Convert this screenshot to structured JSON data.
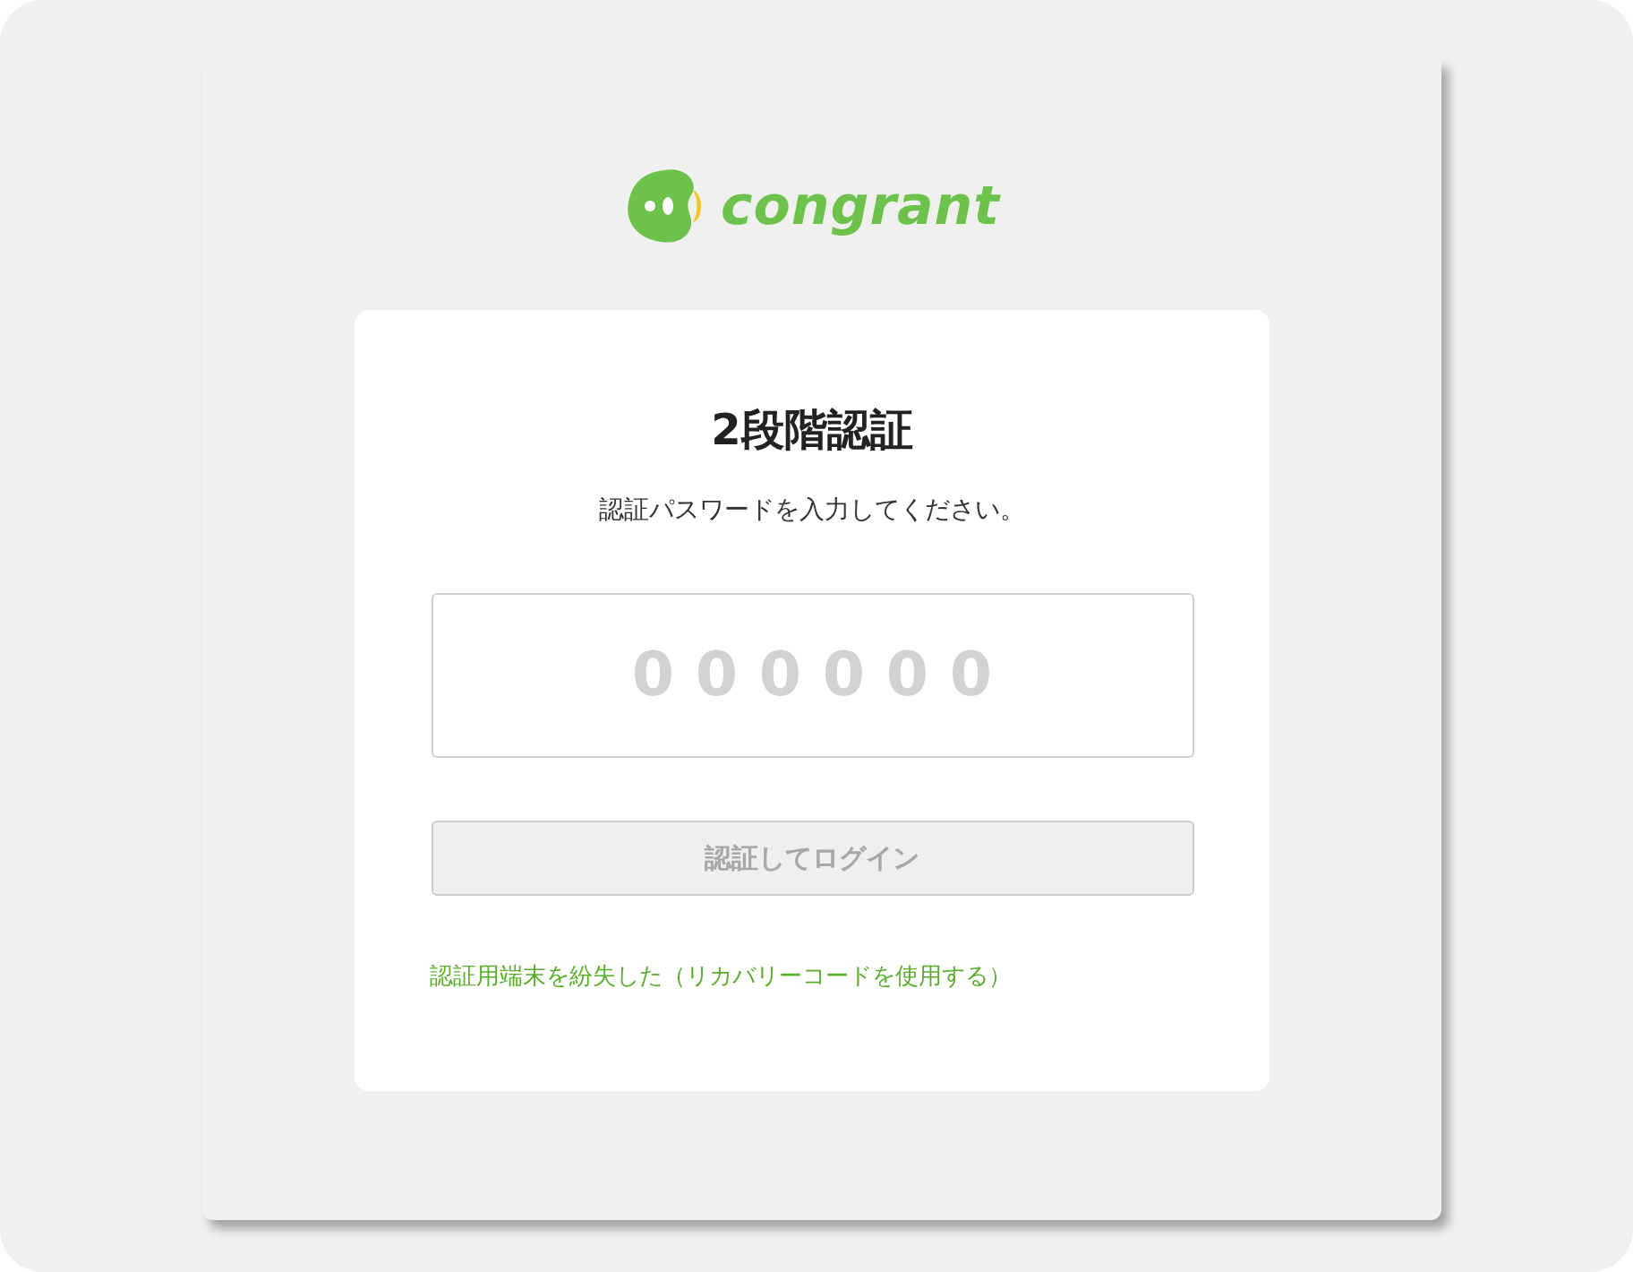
{
  "logo": {
    "text": "congrant"
  },
  "title": "2段階認証",
  "instruction": "認証パスワードを入力してください。",
  "code_field": {
    "placeholder": "0 0 0 0 0 0"
  },
  "login_button": {
    "label": "認証してログイン",
    "disabled": true
  },
  "recovery_link": "認証用端末を紛失した（リカバリーコードを使用する）"
}
